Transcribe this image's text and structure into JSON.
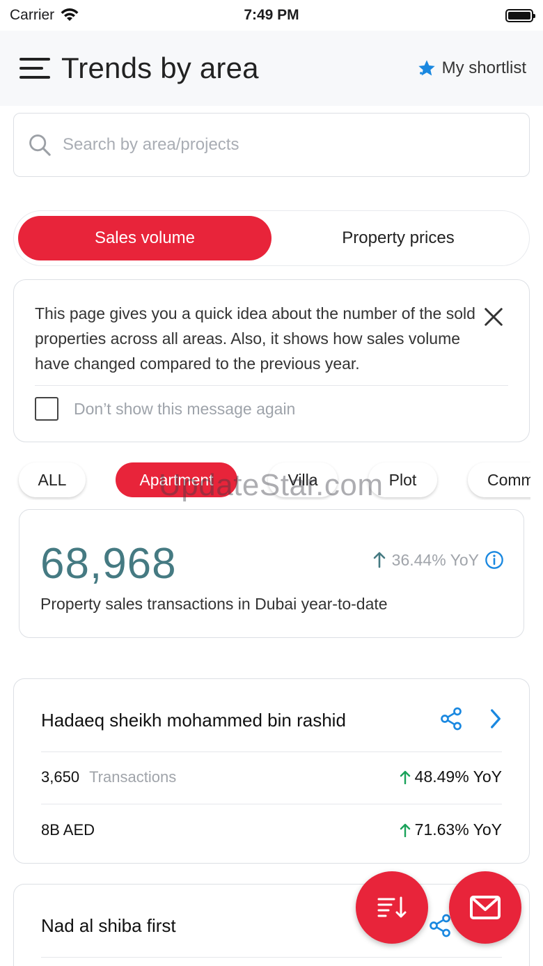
{
  "status_bar": {
    "carrier": "Carrier",
    "time": "7:49 PM"
  },
  "header": {
    "title": "Trends by area",
    "shortlist_label": "My shortlist"
  },
  "search": {
    "placeholder": "Search by area/projects",
    "value": ""
  },
  "tabs": [
    {
      "label": "Sales volume",
      "active": true
    },
    {
      "label": "Property prices",
      "active": false
    }
  ],
  "info_banner": {
    "text": "This page gives you a quick idea about the number of the sold properties across all areas. Also, it shows how sales volume have changed compared to the previous year.",
    "dont_show_label": "Don’t show this message again"
  },
  "filters": [
    {
      "label": "ALL",
      "active": false
    },
    {
      "label": "Apartment",
      "active": true
    },
    {
      "label": "Villa",
      "active": false
    },
    {
      "label": "Plot",
      "active": false
    },
    {
      "label": "Comm",
      "active": false
    }
  ],
  "watermark": "UpdateStar.com",
  "summary": {
    "value": "68,968",
    "yoy": "36.44% YoY",
    "caption": "Property sales transactions in Dubai year-to-date"
  },
  "areas": [
    {
      "name": "Hadaeq sheikh mohammed bin rashid",
      "transactions": "3,650",
      "transactions_label": "Transactions",
      "transactions_yoy": "48.49% YoY",
      "value": "8B AED",
      "value_yoy": "71.63% YoY"
    },
    {
      "name": "Nad al shiba first"
    }
  ],
  "colors": {
    "accent": "#e8243a",
    "teal": "#457a82",
    "up_green": "#1aa25a",
    "link_blue": "#1a88e0"
  },
  "icons": {
    "sort_fab": "sort-icon",
    "mail_fab": "mail-icon"
  }
}
